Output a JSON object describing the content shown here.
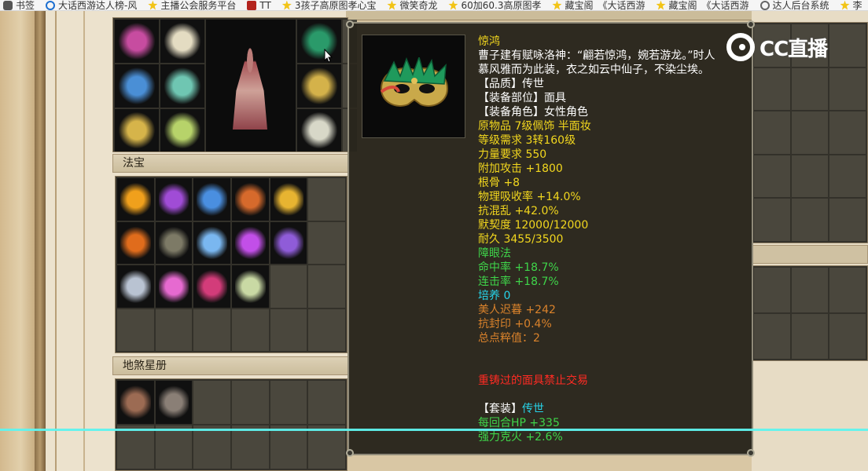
{
  "browser": {
    "bookmarks": [
      {
        "icon": "folder-icon",
        "label": "书签"
      },
      {
        "icon": "globe-icon",
        "label": "大话西游达人榜-风"
      },
      {
        "icon": "star-icon",
        "label": "主播公会服务平台"
      },
      {
        "icon": "app-icon",
        "label": "TT"
      },
      {
        "icon": "star-icon",
        "label": "3孩子高原图孝心宝"
      },
      {
        "icon": "star-icon",
        "label": "微笑奇龙"
      },
      {
        "icon": "star-icon",
        "label": "60加60.3高原图孝"
      },
      {
        "icon": "star-icon",
        "label": "藏宝阁_《大话西游"
      },
      {
        "icon": "star-icon",
        "label": "藏宝阁_《大话西游"
      },
      {
        "icon": "world-icon",
        "label": "达人后台系统"
      },
      {
        "icon": "star-icon",
        "label": "李"
      }
    ]
  },
  "game": {
    "sections": {
      "fabao": "法宝",
      "star_book": "地煞星册"
    },
    "equipment_slots": [
      {
        "name": "tentacle-accessory",
        "color": "#c74ca0"
      },
      {
        "name": "skull-helmet",
        "color": "#e4dcc2"
      },
      {
        "name": "blue-spear",
        "color": "#4a8fd6"
      },
      {
        "name": "green-armor",
        "color": "#6fc6b2"
      },
      {
        "name": "gold-pendant",
        "color": "#d6b44a"
      },
      {
        "name": "green-boots",
        "color": "#b7d36a"
      }
    ],
    "equipment_right_slots": [
      {
        "name": "mask-slot",
        "color": "#2a9a6a"
      },
      {
        "name": "ring-slot",
        "color": "#d4b24a"
      },
      {
        "name": "necklace-slot",
        "color": "#d8d8c8"
      }
    ],
    "fabao_items": [
      {
        "name": "fire-orb",
        "color": "#f0a01c"
      },
      {
        "name": "purple-scroll",
        "color": "#a04cd6"
      },
      {
        "name": "blue-claw",
        "color": "#4a8fe0"
      },
      {
        "name": "pipa",
        "color": "#d66a2c"
      },
      {
        "name": "gold-pagoda",
        "color": "#e7b431"
      },
      {
        "name": "flame-fan",
        "color": "#e06c1c"
      },
      {
        "name": "stone-tablet",
        "color": "#7d7a66"
      },
      {
        "name": "ice-gauntlet",
        "color": "#7ab7f0"
      },
      {
        "name": "purple-whip",
        "color": "#c24fe8"
      },
      {
        "name": "purple-lantern",
        "color": "#8f5cd8"
      },
      {
        "name": "silver-blade",
        "color": "#b9c3d2"
      },
      {
        "name": "pink-lantern",
        "color": "#e66ad0"
      },
      {
        "name": "red-charm",
        "color": "#d33c7a"
      },
      {
        "name": "jade-cube",
        "color": "#c9d9a4"
      }
    ],
    "star_items": [
      {
        "name": "warrior-card-1",
        "color": "#9c6b53"
      },
      {
        "name": "warrior-card-2",
        "color": "#8a7f76"
      }
    ]
  },
  "tooltip": {
    "item_image": "mask-icon",
    "lines": [
      {
        "text": "惊鸿",
        "color": "yellow"
      },
      {
        "text": "曹子建有赋咏洛神：“翩若惊鸿，婉若游龙。”时人",
        "color": "white"
      },
      {
        "text": "慕风雅而为此装，衣之如云中仙子，不染尘埃。",
        "color": "white"
      },
      {
        "text": "【品质】传世",
        "color": "white"
      },
      {
        "text": "【装备部位】面具",
        "color": "white"
      },
      {
        "text": "【装备角色】女性角色",
        "color": "white"
      },
      {
        "text": "原物品 7级佩饰 半面妆",
        "color": "yellow"
      },
      {
        "text": "等级需求 3转160级",
        "color": "yellow"
      },
      {
        "text": "力量要求 550",
        "color": "yellow"
      },
      {
        "text": "附加攻击 +1800",
        "color": "yellow"
      },
      {
        "text": "根骨 +8",
        "color": "yellow"
      },
      {
        "text": "物理吸收率 +14.0%",
        "color": "yellow"
      },
      {
        "text": "抗混乱 +42.0%",
        "color": "yellow"
      },
      {
        "text": "默契度 12000/12000",
        "color": "yellow"
      },
      {
        "text": "耐久 3455/3500",
        "color": "yellow"
      },
      {
        "text": "障眼法",
        "color": "green"
      },
      {
        "text": "命中率 +18.7%",
        "color": "green"
      },
      {
        "text": "连击率 +18.7%",
        "color": "green"
      },
      {
        "text": "培养 0",
        "color": "cyan"
      },
      {
        "text": "美人迟暮 +242",
        "color": "orange"
      },
      {
        "text": "抗封印 +0.4%",
        "color": "orange"
      },
      {
        "text": "总点粹值：2",
        "color": "orange"
      },
      {
        "text": "",
        "color": "white"
      },
      {
        "text": "",
        "color": "white"
      },
      {
        "text": "重铸过的面具禁止交易",
        "color": "red"
      },
      {
        "text": "",
        "color": "white"
      },
      {
        "text": "【套装】",
        "color": "white",
        "suffix": "传世",
        "suffix_color": "cyan"
      },
      {
        "text": "每回合HP +335",
        "color": "green"
      },
      {
        "text": "强力克火 +2.6%",
        "color": "green"
      }
    ]
  },
  "overlay": {
    "logo_text": "CC直播"
  }
}
